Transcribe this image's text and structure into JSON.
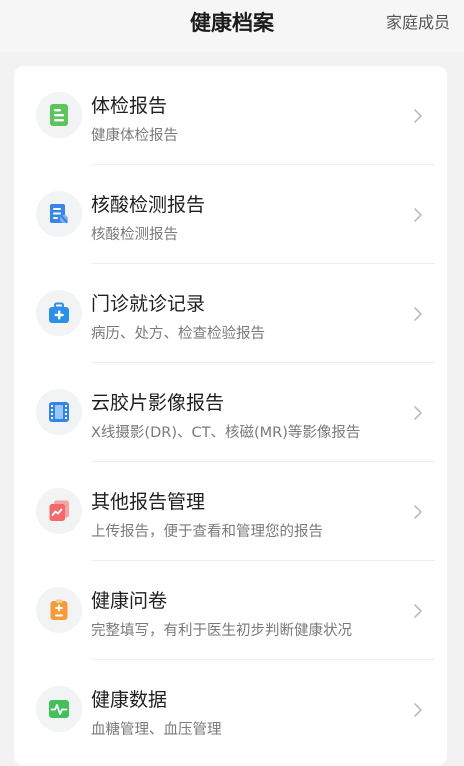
{
  "header": {
    "title": "健康档案",
    "family_link": "家庭成员"
  },
  "items": [
    {
      "title": "体检报告",
      "subtitle": "健康体检报告",
      "icon": "checkup-report-icon",
      "color": "#5cc45a"
    },
    {
      "title": "核酸检测报告",
      "subtitle": "核酸检测报告",
      "icon": "nucleic-test-icon",
      "color": "#3a86e8"
    },
    {
      "title": "门诊就诊记录",
      "subtitle": "病历、处方、检查检验报告",
      "icon": "medical-kit-icon",
      "color": "#2d8fe6"
    },
    {
      "title": "云胶片影像报告",
      "subtitle": "X线摄影(DR)、CT、核磁(MR)等影像报告",
      "icon": "film-icon",
      "color": "#2f86e6"
    },
    {
      "title": "其他报告管理",
      "subtitle": "上传报告，便于查看和管理您的报告",
      "icon": "report-stack-icon",
      "color": "#f26a6a"
    },
    {
      "title": "健康问卷",
      "subtitle": "完整填写，有利于医生初步判断健康状况",
      "icon": "questionnaire-icon",
      "color": "#f59b3a"
    },
    {
      "title": "健康数据",
      "subtitle": "血糖管理、血压管理",
      "icon": "heart-rate-icon",
      "color": "#43c05a"
    }
  ]
}
